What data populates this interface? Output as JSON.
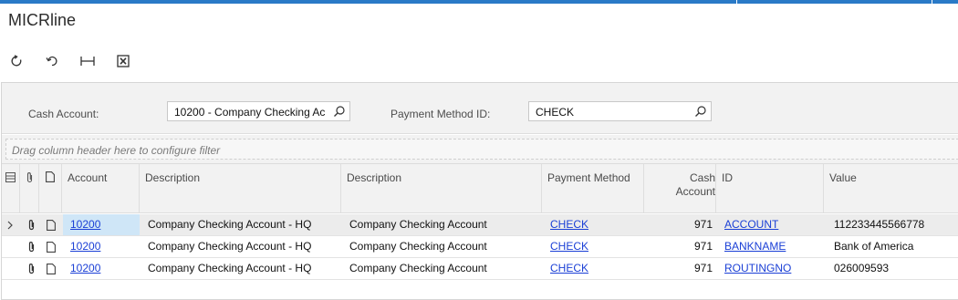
{
  "page": {
    "title": "MICRline"
  },
  "toolbar": [
    {
      "icon": "refresh-icon"
    },
    {
      "icon": "undo-icon"
    },
    {
      "icon": "fit-to-screen-icon"
    },
    {
      "icon": "export-excel-icon"
    }
  ],
  "form": {
    "cash_account_label": "Cash Account:",
    "cash_account_value": "10200 - Company Checking Ac",
    "payment_method_label": "Payment Method ID:",
    "payment_method_value": "CHECK"
  },
  "filter": {
    "placeholder": "Drag column header here to configure filter"
  },
  "columns": {
    "account": "Account",
    "description1": "Description",
    "description2": "Description",
    "payment_method": "Payment Method",
    "cash_account_line1": "Cash",
    "cash_account_line2": "Account",
    "id": "ID",
    "value": "Value"
  },
  "rows": [
    {
      "account": "10200",
      "description1": "Company Checking Account - HQ",
      "description2": "Company Checking Account",
      "payment_method": "CHECK",
      "cash_account": "971",
      "id": "ACCOUNT",
      "value": "112233445566778"
    },
    {
      "account": "10200",
      "description1": "Company Checking Account - HQ",
      "description2": "Company Checking Account",
      "payment_method": "CHECK",
      "cash_account": "971",
      "id": "BANKNAME",
      "value": "Bank of America"
    },
    {
      "account": "10200",
      "description1": "Company Checking Account - HQ",
      "description2": "Company Checking Account",
      "payment_method": "CHECK",
      "cash_account": "971",
      "id": "ROUTINGNO",
      "value": "026009593"
    }
  ],
  "colors": {
    "accent": "#2a7ac7",
    "link": "#1a3fd6",
    "selected_row": "#ececec",
    "selected_cell": "#cfe6f7"
  }
}
